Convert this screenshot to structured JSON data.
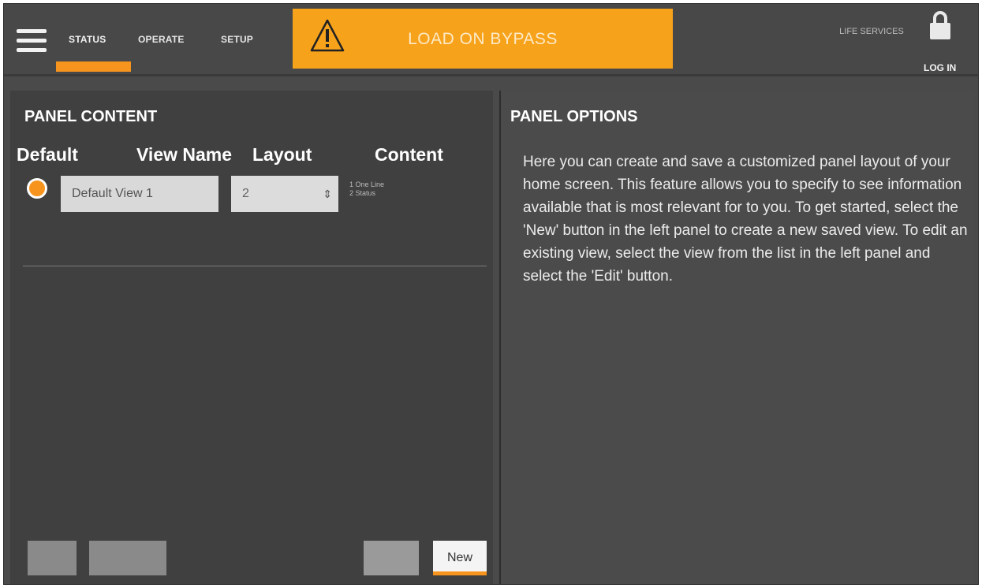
{
  "nav": {
    "tabs": [
      "STATUS",
      "OPERATE",
      "SETUP"
    ],
    "active_tab": "STATUS"
  },
  "alarm_banner": {
    "text": "LOAD ON BYPASS",
    "icon": "warning-icon",
    "color": "#f7a21b"
  },
  "header_right": {
    "life_services": "LIFE SERVICES",
    "login": "LOG IN",
    "lock_icon": "lock-icon"
  },
  "left_panel": {
    "title": "PANEL CONTENT",
    "columns": [
      "Default",
      "View Name",
      "Layout",
      "Content"
    ],
    "rows": [
      {
        "default_selected": true,
        "view_name": "Default View 1",
        "layout": "2",
        "content": [
          "1 One Line",
          "2 Status"
        ]
      }
    ],
    "buttons": {
      "new": "New"
    }
  },
  "right_panel": {
    "title": "PANEL OPTIONS",
    "description": "Here you can create and save a customized panel layout of your home screen. This feature allows you to specify to see information available that is most relevant for to you. To get started, select the 'New' button in the left panel to create a new saved view. To edit an existing view, select the view from the list in the left panel and select the 'Edit' button."
  },
  "colors": {
    "accent": "#f7941d",
    "background": "#4a4a4a"
  }
}
